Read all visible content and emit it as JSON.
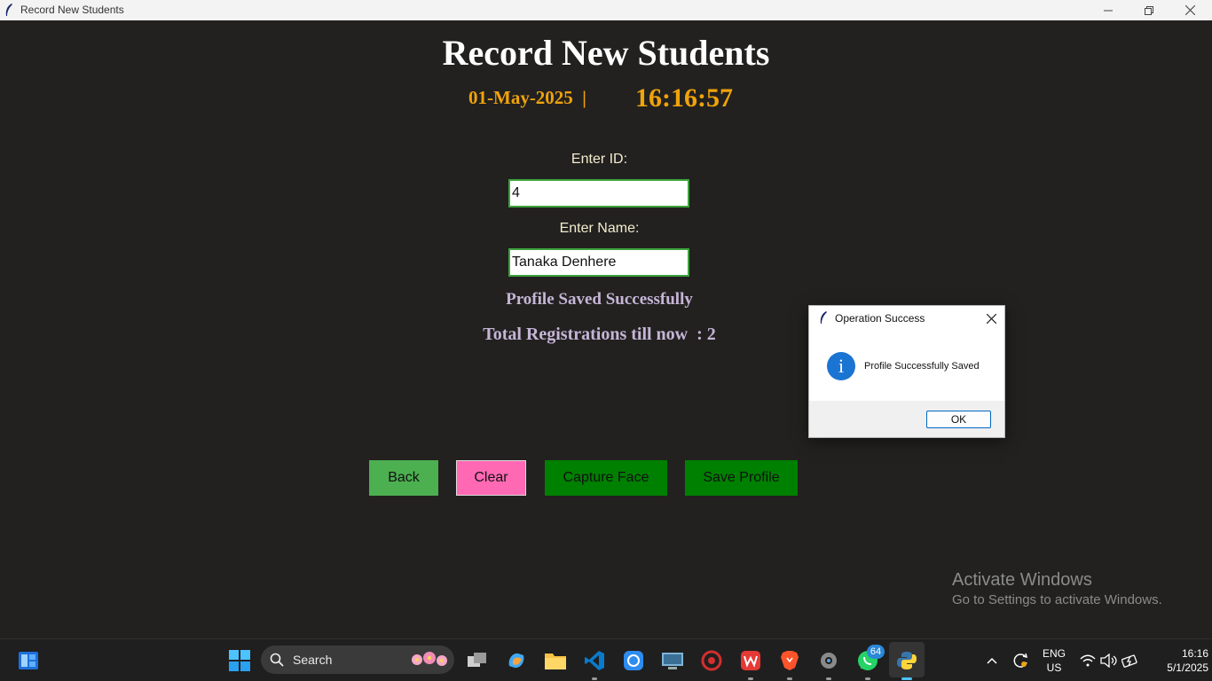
{
  "window": {
    "title": "Record New Students",
    "controls": [
      "minimize-icon",
      "restore-icon",
      "close-icon"
    ]
  },
  "header": {
    "title": "Record New Students",
    "date": "01-May-2025  |",
    "time": "16:16:57"
  },
  "form": {
    "id_label": "Enter ID:",
    "id_value": "4",
    "name_label": "Enter Name:",
    "name_value": "Tanaka Denhere"
  },
  "status": {
    "message": "Profile Saved Successfully",
    "registrations": "Total Registrations till now  : 2"
  },
  "buttons": {
    "back": "Back",
    "clear": "Clear",
    "capture": "Capture Face",
    "save": "Save Profile"
  },
  "dialog": {
    "title": "Operation Success",
    "icon": "info-icon",
    "message": "Profile Successfully Saved",
    "ok": "OK"
  },
  "watermark": {
    "line1": "Activate Windows",
    "line2": "Go to Settings to activate Windows."
  },
  "taskbar": {
    "search_label": "Search",
    "whatsapp_badge": "64",
    "lang_line1": "ENG",
    "lang_line2": "US",
    "clock_time": "16:16",
    "clock_date": "5/1/2025"
  },
  "colors": {
    "background": "#222120",
    "accent_date": "#f0a30a",
    "back_button": "#4caf50",
    "clear_button": "#ff69b4",
    "green_button": "#008000"
  }
}
